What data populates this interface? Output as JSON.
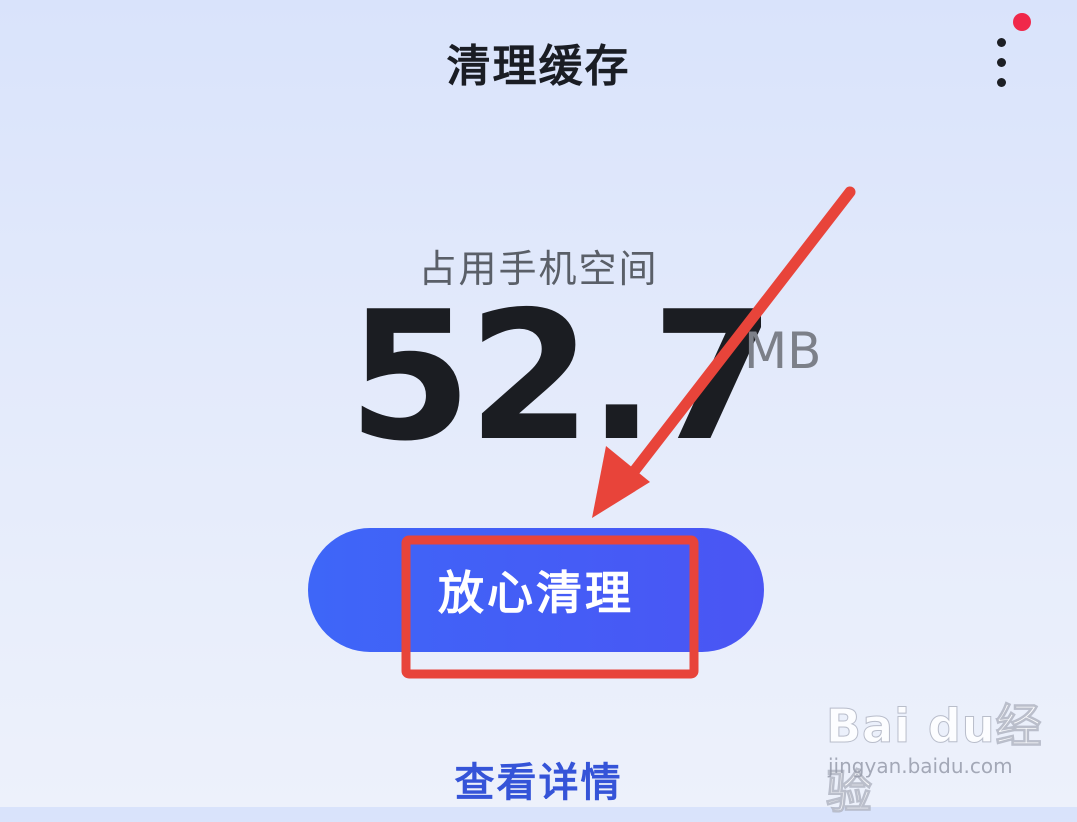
{
  "header": {
    "title": "清理缓存",
    "menu_icon": "more-vertical-icon",
    "notification_color": "#f0284a"
  },
  "storage": {
    "label": "占用手机空间",
    "value": "52.7",
    "unit": "MB"
  },
  "actions": {
    "clean_label": "放心清理",
    "details_label": "查看详情"
  },
  "annotation": {
    "arrow_color": "#e8443a",
    "highlight_color": "#e8443a"
  },
  "watermark": {
    "brand": "Bai du经验",
    "url": "jingyan.baidu.com"
  },
  "colors": {
    "accent": "#3e66f8",
    "link": "#3554d8"
  }
}
